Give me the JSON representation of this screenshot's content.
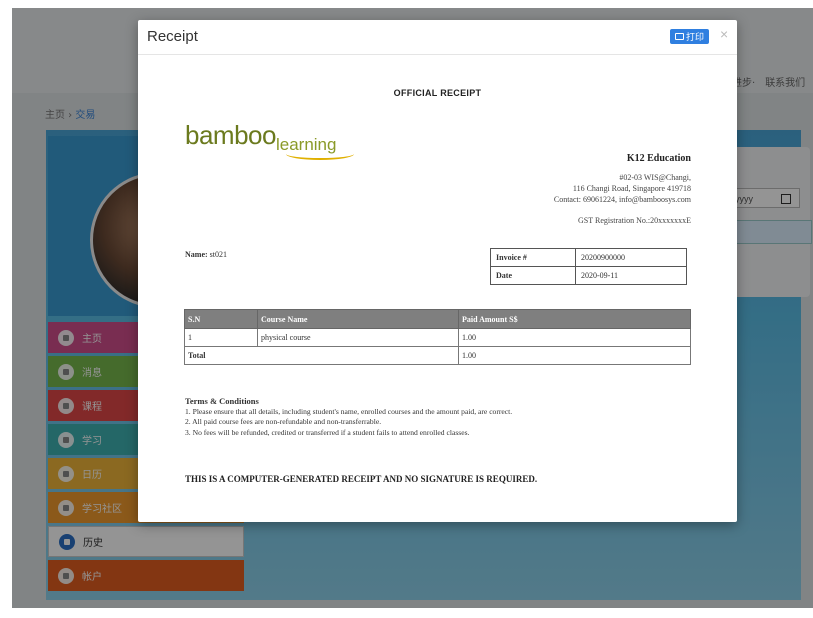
{
  "background": {
    "top_nav": [
      "进步·",
      "联系我们"
    ],
    "breadcrumb": {
      "home": "主页",
      "sep": " › ",
      "current": "交易"
    },
    "date_placeholder": "yyyy",
    "menu": [
      {
        "label": "主页",
        "icon": "home-icon",
        "color": "#d04f8c"
      },
      {
        "label": "消息",
        "icon": "message-icon",
        "color": "#77b84d"
      },
      {
        "label": "课程",
        "icon": "course-icon",
        "color": "#e04848"
      },
      {
        "label": "学习",
        "icon": "study-icon",
        "color": "#3fb2b2"
      },
      {
        "label": "日历",
        "icon": "calendar-icon",
        "color": "#f0b63a"
      },
      {
        "label": "学习社区",
        "icon": "community-icon",
        "color": "#f09a2e"
      },
      {
        "label": "历史",
        "icon": "history-icon",
        "color": "#ffffff"
      },
      {
        "label": "帐户",
        "icon": "account-icon",
        "color": "#e25d1f"
      }
    ]
  },
  "modal": {
    "title": "Receipt",
    "print_label": "打印",
    "close_label": "×"
  },
  "receipt": {
    "heading": "OFFICIAL RECEIPT",
    "logo": {
      "main": "bamboo",
      "sub": "learning"
    },
    "company": "K12 Education",
    "address_lines": [
      "#02-03 WIS@Changi,",
      "116 Changi Road, Singapore 419718",
      "Contact: 69061224, info@bamboosys.com"
    ],
    "gst": "GST Registration No.:20xxxxxxxE",
    "name_label": "Name:",
    "name_value": "st021",
    "invoice": [
      {
        "key": "Invoice #",
        "value": "20200900000"
      },
      {
        "key": "Date",
        "value": "2020-09-11"
      }
    ],
    "table": {
      "headers": [
        "S.N",
        "Course Name",
        "Paid Amount S$"
      ],
      "rows": [
        {
          "sn": "1",
          "course": "physical course",
          "amount": "1.00"
        }
      ],
      "total_label": "Total",
      "total_value": "1.00"
    },
    "terms_title": "Terms & Conditions",
    "terms": [
      "1. Please ensure that all details, including student's name, enrolled courses and the amount paid, are correct.",
      "2. All paid course fees are non-refundable and non-transferrable.",
      "3. No fees will be refunded, credited or transferred if a student fails to attend enrolled classes."
    ],
    "footer": "THIS IS A COMPUTER-GENERATED RECEIPT AND NO SIGNATURE IS REQUIRED."
  }
}
